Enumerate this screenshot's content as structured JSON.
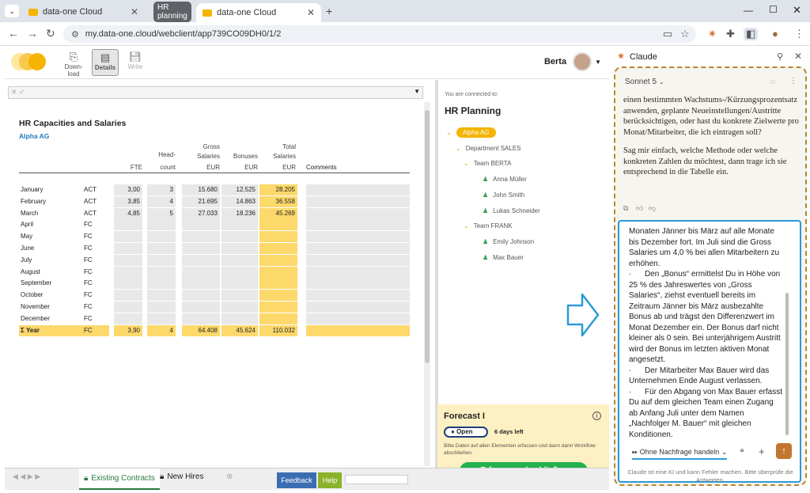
{
  "browser": {
    "tabs": [
      {
        "label": "data-one Cloud"
      },
      {
        "label": "HR planning"
      },
      {
        "label": "data-one Cloud"
      }
    ],
    "url": "my.data-one.cloud/webclient/app739CO09DH0/1/2"
  },
  "toolbar": {
    "download_label": "Down-load",
    "details_label": "Details",
    "write_label": "Write",
    "user_name": "Berta"
  },
  "sheet": {
    "title": "HR Capacities and Salaries",
    "subtitle": "Alpha AG",
    "headers": {
      "fte": "FTE",
      "headcount_top": "Head-",
      "headcount_bottom": "count",
      "gross_top": "Gross",
      "gross_mid": "Salaries",
      "gross_unit": "EUR",
      "bonuses_top": "Bonuses",
      "bonuses_unit": "EUR",
      "total_top": "Total",
      "total_mid": "Salaries",
      "total_unit": "EUR",
      "comments": "Comments"
    },
    "rows": [
      {
        "month": "January",
        "type": "ACT",
        "fte": "3,00",
        "hc": "3",
        "gross": "15.680",
        "bonus": "12.525",
        "total": "28.205"
      },
      {
        "month": "February",
        "type": "ACT",
        "fte": "3,85",
        "hc": "4",
        "gross": "21.695",
        "bonus": "14.863",
        "total": "36.558"
      },
      {
        "month": "March",
        "type": "ACT",
        "fte": "4,85",
        "hc": "5",
        "gross": "27.033",
        "bonus": "18.236",
        "total": "45.269"
      },
      {
        "month": "April",
        "type": "FC",
        "fte": "",
        "hc": "",
        "gross": "",
        "bonus": "",
        "total": ""
      },
      {
        "month": "May",
        "type": "FC",
        "fte": "",
        "hc": "",
        "gross": "",
        "bonus": "",
        "total": ""
      },
      {
        "month": "June",
        "type": "FC",
        "fte": "",
        "hc": "",
        "gross": "",
        "bonus": "",
        "total": ""
      },
      {
        "month": "July",
        "type": "FC",
        "fte": "",
        "hc": "",
        "gross": "",
        "bonus": "",
        "total": ""
      },
      {
        "month": "August",
        "type": "FC",
        "fte": "",
        "hc": "",
        "gross": "",
        "bonus": "",
        "total": ""
      },
      {
        "month": "September",
        "type": "FC",
        "fte": "",
        "hc": "",
        "gross": "",
        "bonus": "",
        "total": ""
      },
      {
        "month": "October",
        "type": "FC",
        "fte": "",
        "hc": "",
        "gross": "",
        "bonus": "",
        "total": ""
      },
      {
        "month": "November",
        "type": "FC",
        "fte": "",
        "hc": "",
        "gross": "",
        "bonus": "",
        "total": ""
      },
      {
        "month": "December",
        "type": "FC",
        "fte": "",
        "hc": "",
        "gross": "",
        "bonus": "",
        "total": ""
      }
    ],
    "total_row": {
      "month": "Σ Year",
      "type": "FC",
      "fte": "3,90",
      "hc": "4",
      "gross": "64.408",
      "bonus": "45.624",
      "total": "110.032"
    }
  },
  "midpanel": {
    "connected_label": "You are connected to:",
    "title": "HR Planning",
    "tree": [
      {
        "label": "Alpha AG",
        "kind": "root"
      },
      {
        "label": "Department SALES",
        "kind": "folder"
      },
      {
        "label": "Team BERTA",
        "kind": "folder"
      },
      {
        "label": "Anna Müller",
        "kind": "person"
      },
      {
        "label": "John Smith",
        "kind": "person"
      },
      {
        "label": "Lukas Schneider",
        "kind": "person"
      },
      {
        "label": "Team FRANK",
        "kind": "folder"
      },
      {
        "label": "Emily Johnson",
        "kind": "person"
      },
      {
        "label": "Max Bauer",
        "kind": "person"
      }
    ]
  },
  "forecast": {
    "title": "Forecast I",
    "status": "Open",
    "days_left": "6 days left",
    "hint": "Bitte Daten auf allen Elementen erfassen und dann dann Workflow abschließen.",
    "button": "Erfassung abschließen"
  },
  "bottombar": {
    "tab1": "Existing Contracts",
    "tab2": "New Hires",
    "feedback": "Feedback",
    "help": "Help"
  },
  "claude": {
    "title": "Claude",
    "model": "Sonnet 5",
    "message_p1": "einen bestimmten Wachstums-/Kürzungsprozentsatz anwenden, geplante Neueinstellungen/Austritte berücksichtigen, oder hast du konkrete Zielwerte pro Monat/Mitarbeiter, die ich eintragen soll?",
    "message_p2": "Sag mir einfach, welche Methode oder welche konkreten Zahlen du möchtest, dann trage ich sie entsprechend in die Tabelle ein.",
    "input_text": "Monaten Jänner bis März auf alle Monate bis Dezember fort. Im Juli sind die Gross Salaries um 4,0 % bei allen Mitarbeitern zu erhöhen.\n·      Den „Bonus“ ermittelst Du in Höhe von 25 % des Jahreswertes von „Gross Salaries“, ziehst eventuell bereits im Zeitraum Jänner bis März ausbezahlte Bonus ab und trägst den Differenzwert im Monat Dezember ein. Der Bonus darf nicht kleiner als 0 sein. Bei unterjährigem Austritt wird der Bonus im letzten aktiven Monat angesetzt.\n·      Der Mitarbeiter Max Bauer wird das Unternehmen Ende August verlassen.\n·      Für den Abgang von Max Bauer erfasst Du auf dem gleichen Team einen Zugang ab Anfang Juli unter dem Namen „Nachfolger M. Bauer“ mit gleichen Konditionen.",
    "mode_label": "Ohne Nachfrage handeln",
    "disclaimer": "Claude ist eine KI und kann Fehler machen. Bitte überprüfe die Antworten."
  },
  "colors": {
    "accent_yellow": "#fdd86b",
    "green_button": "#22b14c",
    "claude_border": "#b8862f",
    "input_border": "#2a9bd6"
  }
}
